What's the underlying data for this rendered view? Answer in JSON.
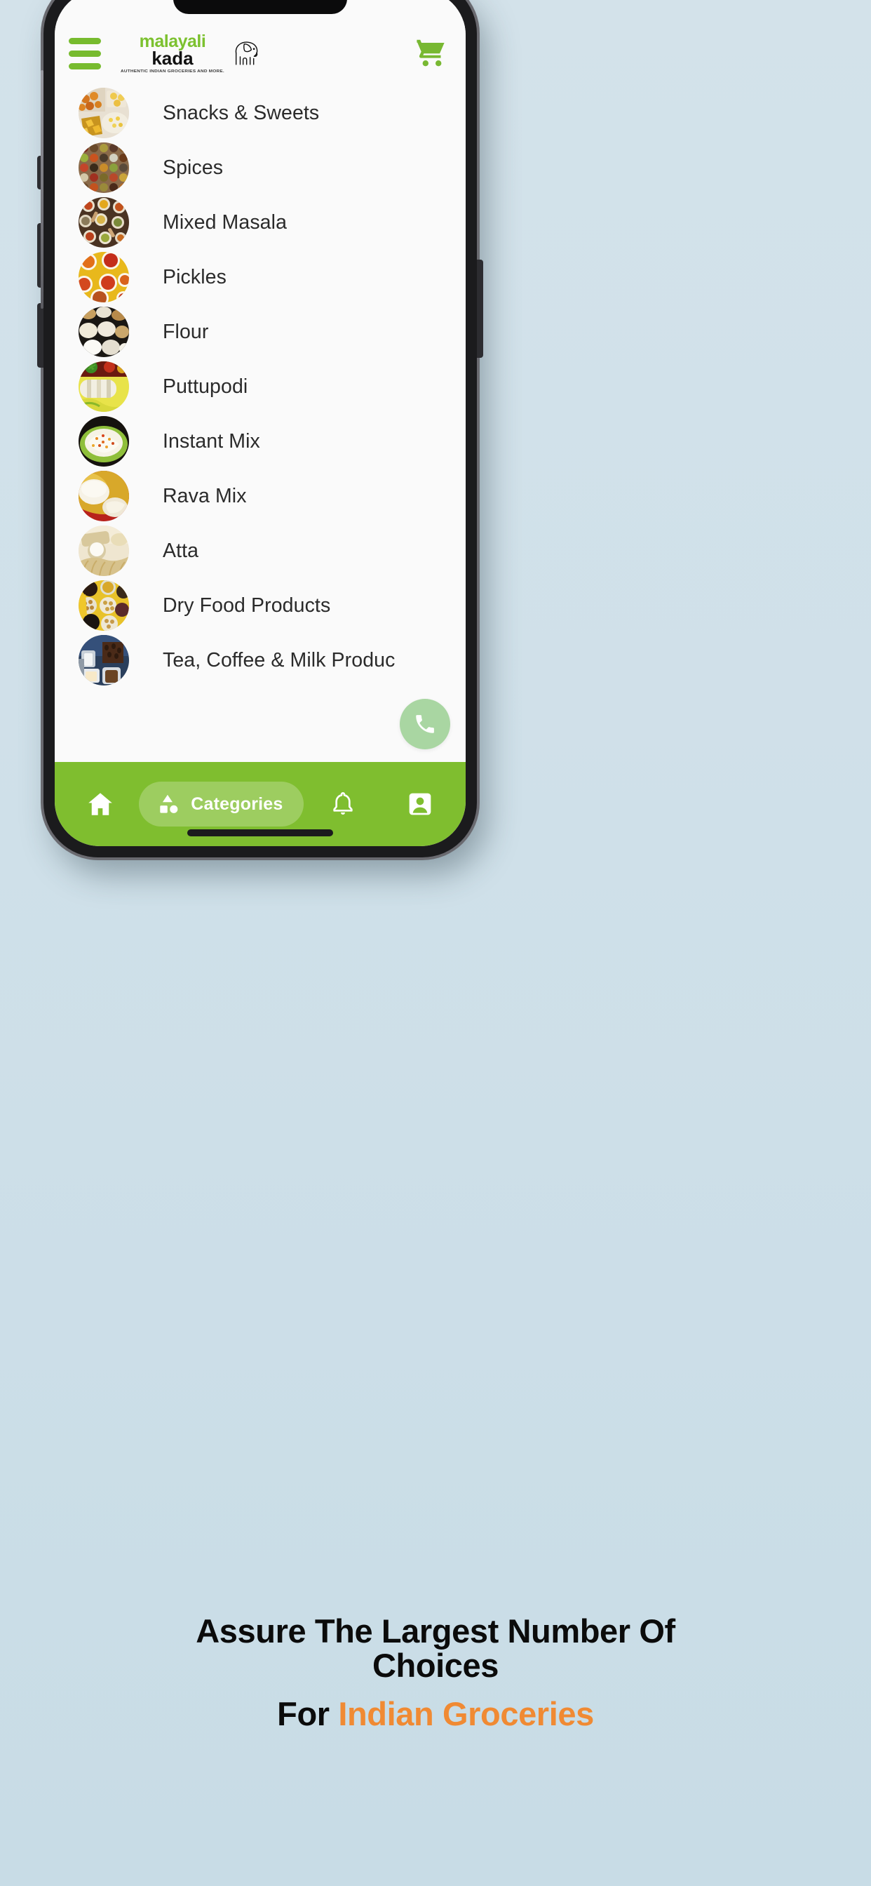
{
  "background_color": "#d3e2ea",
  "brand": {
    "line1": "malayali",
    "line2": "kada",
    "tagline": "AUTHENTIC INDIAN GROCERIES AND MORE.",
    "green": "#7cc12f",
    "logo_icon": "elephant-icon"
  },
  "header": {
    "menu_icon": "hamburger-menu-icon",
    "cart_icon": "shopping-cart-icon",
    "cart_color": "#78b832"
  },
  "categories": [
    {
      "label": "Snacks & Sweets",
      "image": "snacks-and-sweets-thumbnail"
    },
    {
      "label": "Spices",
      "image": "spices-thumbnail"
    },
    {
      "label": "Mixed Masala",
      "image": "mixed-masala-thumbnail"
    },
    {
      "label": "Pickles",
      "image": "pickles-thumbnail"
    },
    {
      "label": "Flour",
      "image": "flour-thumbnail"
    },
    {
      "label": "Puttupodi",
      "image": "puttupodi-thumbnail"
    },
    {
      "label": "Instant Mix",
      "image": "instant-mix-thumbnail"
    },
    {
      "label": "Rava Mix",
      "image": "rava-mix-thumbnail"
    },
    {
      "label": "Atta",
      "image": "atta-thumbnail"
    },
    {
      "label": "Dry Food Products",
      "image": "dry-food-products-thumbnail"
    },
    {
      "label": "Tea, Coffee & Milk Produc",
      "image": "tea-coffee-milk-thumbnail"
    }
  ],
  "call_fab": {
    "icon": "phone-icon",
    "color": "#a9d6a2"
  },
  "bottom_nav": {
    "bar_color": "#7fbe2f",
    "items": [
      {
        "label": "",
        "icon": "home-icon",
        "active": false
      },
      {
        "label": "Categories",
        "icon": "categories-icon",
        "active": true
      },
      {
        "label": "",
        "icon": "bell-icon",
        "active": false
      },
      {
        "label": "",
        "icon": "account-icon",
        "active": false
      }
    ]
  },
  "caption": {
    "line1": "Assure The Largest Number Of",
    "line2": "Choices",
    "line3_prefix": "For ",
    "line3_highlight": "Indian Groceries",
    "highlight_color": "#f08a33"
  }
}
